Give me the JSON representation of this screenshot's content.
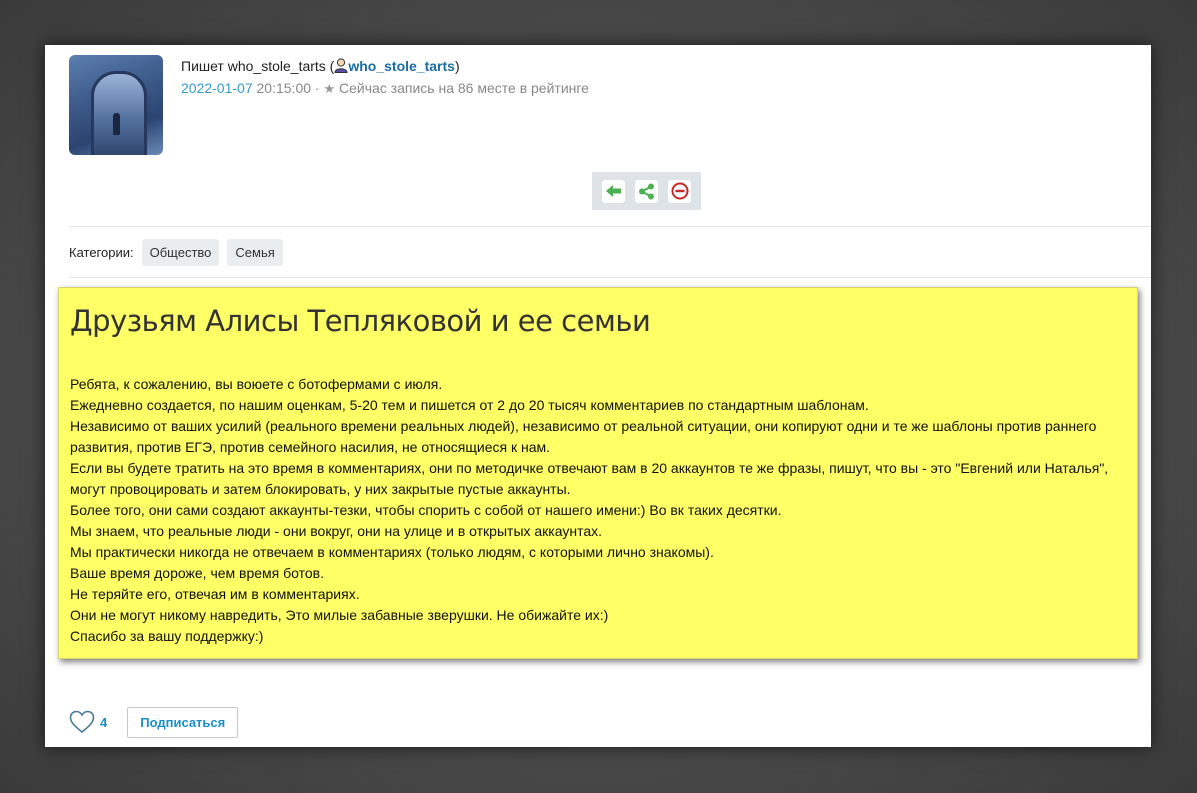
{
  "header": {
    "author_prefix": "Пишет who_stole_tarts (",
    "author_link": "who_stole_tarts",
    "author_suffix": ")",
    "date": "2022-01-07",
    "time": " 20:15:00 ·",
    "rating_text": "Сейчас запись на 86 месте в рейтинге"
  },
  "icons": {
    "back": "arrow-left-icon",
    "share": "share-icon",
    "block": "block-icon",
    "user": "user-icon",
    "star": "star-icon",
    "like": "heart-icon"
  },
  "colors": {
    "post_background": "#ffff66",
    "link": "#1c6ea0",
    "accent": "#1a8fc7",
    "green_icon": "#4caf50",
    "red_icon": "#c62828"
  },
  "categories": {
    "label": "Категории:",
    "items": [
      "Общество",
      "Семья"
    ]
  },
  "post": {
    "title": "Друзьям Алисы Тепляковой и ее семьи",
    "paragraphs": [
      "Ребята, к сожалению, вы воюете с ботофермами с июля.",
      "Ежедневно создается, по нашим оценкам, 5-20 тем и пишется от 2 до 20 тысяч комментариев по стандартным шаблонам.",
      "Независимо от ваших усилий (реального времени реальных людей), независимо от реальной ситуации, они копируют одни и те же шаблоны против раннего развития, против ЕГЭ, против семейного насилия, не относящиеся к нам.",
      "Если вы будете тратить на это время в комментариях, они по методичке отвечают вам в 20 аккаунтов те же фразы, пишут, что вы - это \"Евгений или Наталья\", могут провоцировать и затем блокировать, у них закрытые пустые аккаунты.",
      "Более того, они сами создают аккаунты-тезки, чтобы спорить с собой от нашего имени:) Во вк таких десятки.",
      "Мы знаем, что реальные люди - они вокруг, они на улице и в открытых аккаунтах.",
      "Мы практически никогда не отвечаем в комментариях (только людям, с которыми лично знакомы).",
      "Ваше время дороже, чем время ботов.",
      "Не теряйте его, отвечая им в комментариях.",
      "Они не могут никому навредить, Это милые забавные зверушки. Не обижайте их:)",
      "Спасибо за вашу поддержку:)"
    ]
  },
  "footer": {
    "like_count": "4",
    "subscribe_label": "Подписаться"
  }
}
